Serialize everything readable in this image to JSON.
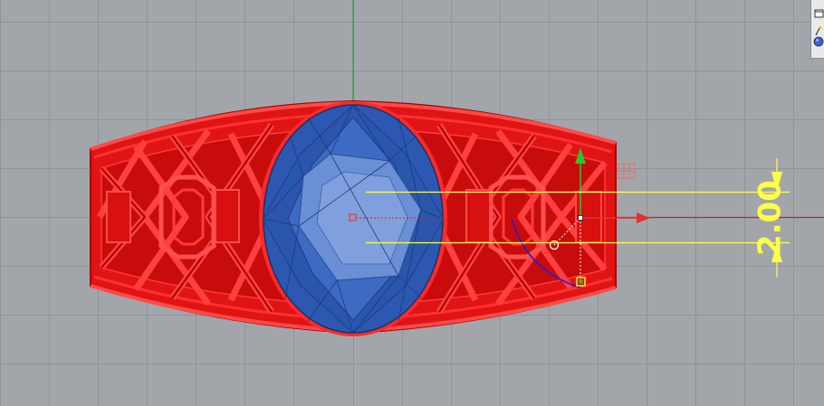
{
  "viewport": {
    "name": "front-viewport",
    "background_color": "#a2a6aa",
    "grid_color": "#8f9397",
    "axis_y_color": "#2aa02a",
    "axis_x_color": "#cc1f1f"
  },
  "model": {
    "band_color": "#ff1a1a",
    "band_edge_color": "#c00000",
    "gem_color": "#2f5db8",
    "gem_light_color": "#5a82d0",
    "gem_edge_color": "#17356e"
  },
  "dimension": {
    "text": "2.00",
    "color": "#ffff4a"
  },
  "gumball": {
    "x_arrow_color": "#e53030",
    "y_arrow_color": "#30c030",
    "rotate_arc_color": "#2020c8"
  },
  "toolbar": {
    "items": [
      {
        "icon": "window-icon"
      },
      {
        "icon": "wand-icon"
      },
      {
        "icon": "render-sphere-icon"
      }
    ]
  }
}
